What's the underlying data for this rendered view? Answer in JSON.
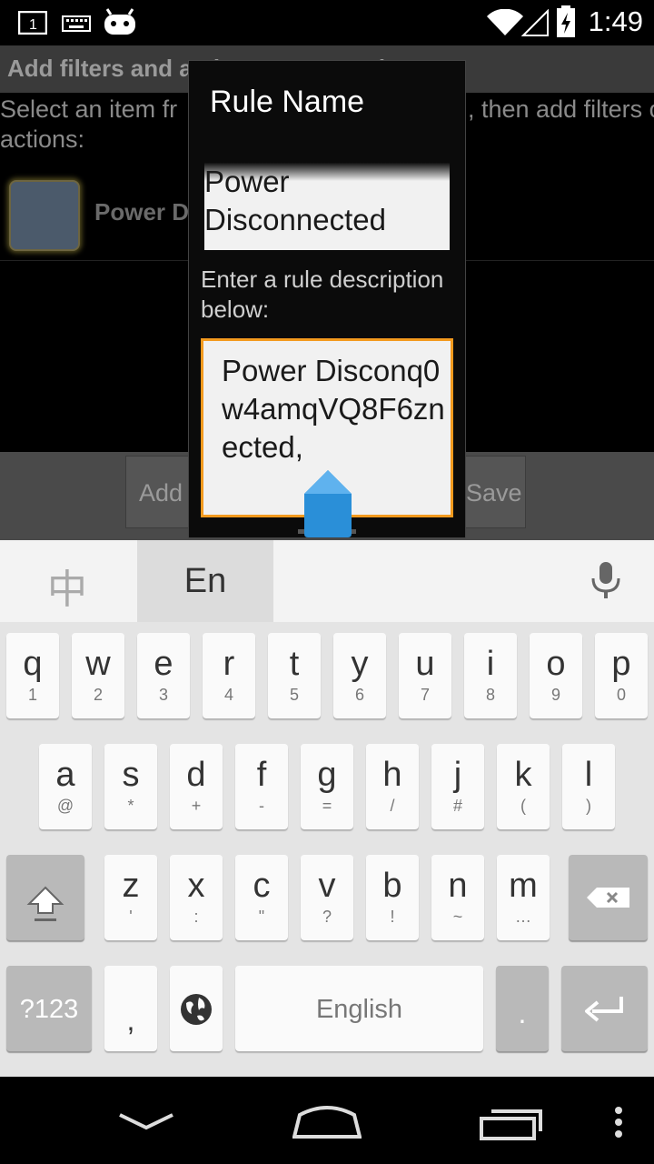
{
  "status_bar": {
    "time": "1:49",
    "notification_count": "1"
  },
  "background_activity": {
    "title": "Add filters and actions to your rule",
    "instruction_left": "Select an item fr\nactions:",
    "instruction_right": ", then add filters or",
    "rule_item_label": "Power Di",
    "add_button_label": "Add",
    "save_button_label": "Save"
  },
  "dialog": {
    "title": "Rule Name",
    "name_value": "Power\nDisconnected",
    "description_label": "Enter a rule description below:",
    "description_value": "Power Disconq0w4amqVQ8F6znected,"
  },
  "keyboard": {
    "lang_chinese": "中",
    "lang_english": "En",
    "row1": [
      {
        "k": "q",
        "s": "1"
      },
      {
        "k": "w",
        "s": "2"
      },
      {
        "k": "e",
        "s": "3"
      },
      {
        "k": "r",
        "s": "4"
      },
      {
        "k": "t",
        "s": "5"
      },
      {
        "k": "y",
        "s": "6"
      },
      {
        "k": "u",
        "s": "7"
      },
      {
        "k": "i",
        "s": "8"
      },
      {
        "k": "o",
        "s": "9"
      },
      {
        "k": "p",
        "s": "0"
      }
    ],
    "row2": [
      {
        "k": "a",
        "s": "@"
      },
      {
        "k": "s",
        "s": "*"
      },
      {
        "k": "d",
        "s": "+"
      },
      {
        "k": "f",
        "s": "-"
      },
      {
        "k": "g",
        "s": "="
      },
      {
        "k": "h",
        "s": "/"
      },
      {
        "k": "j",
        "s": "#"
      },
      {
        "k": "k",
        "s": "("
      },
      {
        "k": "l",
        "s": ")"
      }
    ],
    "row3": [
      {
        "k": "z",
        "s": "'"
      },
      {
        "k": "x",
        "s": ":"
      },
      {
        "k": "c",
        "s": "\""
      },
      {
        "k": "v",
        "s": "?"
      },
      {
        "k": "b",
        "s": "!"
      },
      {
        "k": "n",
        "s": "~"
      },
      {
        "k": "m",
        "s": "…"
      }
    ],
    "symbols_label": "?123",
    "comma_label": ",",
    "space_label": "English",
    "period_label": "."
  },
  "icons": {
    "status": [
      "notification-icon",
      "keyboard-icon",
      "cyanogenmod-icon",
      "wifi-icon",
      "signal-icon",
      "battery-icon"
    ],
    "keyboard": [
      "mic-icon",
      "shift-icon",
      "backspace-icon",
      "globe-icon",
      "enter-icon"
    ],
    "nav": [
      "back-icon",
      "home-icon",
      "recents-icon",
      "menu-icon"
    ]
  },
  "colors": {
    "focus_orange": "#f39a1e",
    "handle_blue": "#2a8fd8"
  }
}
